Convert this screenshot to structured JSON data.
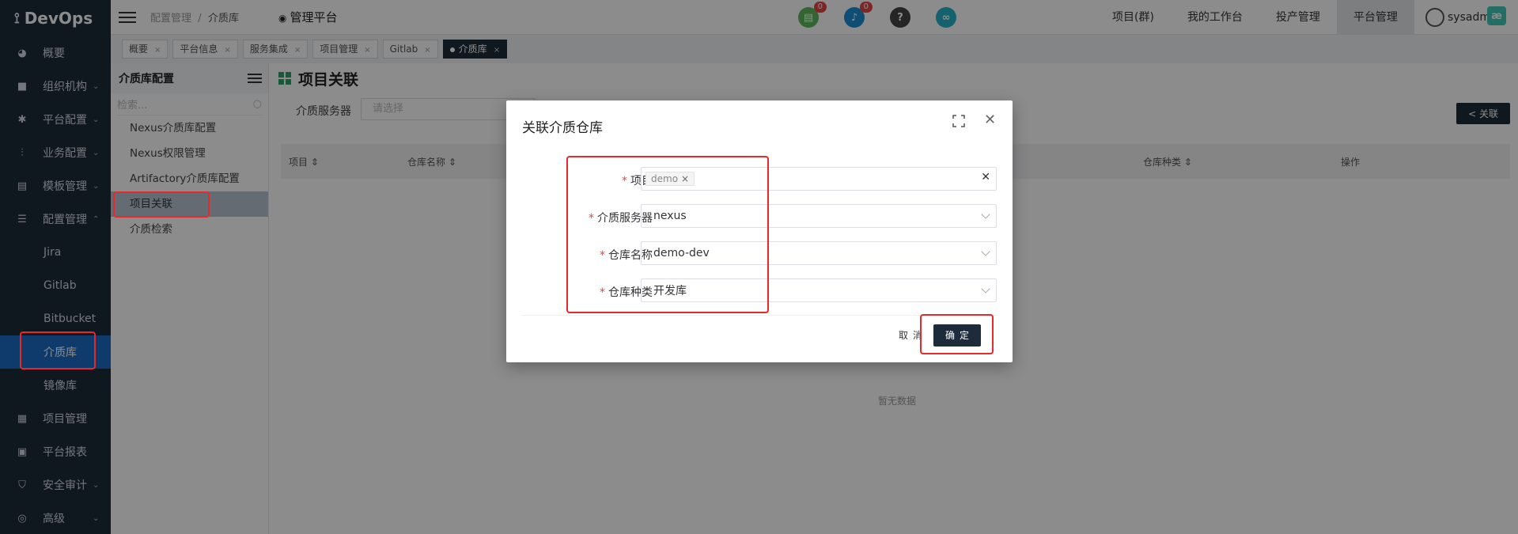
{
  "app": {
    "brand": "DevOps"
  },
  "sidebar": {
    "items": [
      {
        "label": "概要",
        "icon": "dashboard-icon",
        "chev": ""
      },
      {
        "label": "组织机构",
        "icon": "lock-icon",
        "chev": "⌄"
      },
      {
        "label": "平台配置",
        "icon": "gear-icon",
        "chev": "⌄"
      },
      {
        "label": "业务配置",
        "icon": "sliders-icon",
        "chev": "⌄"
      },
      {
        "label": "模板管理",
        "icon": "template-icon",
        "chev": "⌄"
      },
      {
        "label": "配置管理",
        "icon": "database-icon",
        "chev": "⌃"
      }
    ],
    "sub_items": [
      {
        "label": "Jira"
      },
      {
        "label": "Gitlab"
      },
      {
        "label": "Bitbucket"
      },
      {
        "label": "介质库"
      },
      {
        "label": "镜像库"
      }
    ],
    "bottom_items": [
      {
        "label": "项目管理",
        "icon": "grid-icon",
        "chev": ""
      },
      {
        "label": "平台报表",
        "icon": "monitor-icon",
        "chev": ""
      },
      {
        "label": "安全审计",
        "icon": "shield-icon",
        "chev": "⌄"
      },
      {
        "label": "高级",
        "icon": "advanced-icon",
        "chev": "⌄"
      }
    ]
  },
  "topbar": {
    "breadcrumb": {
      "parent": "配置管理",
      "sep": "/",
      "current": "介质库"
    },
    "platform_title": "管理平台",
    "badges": {
      "doc": "0",
      "bell": "0"
    },
    "menu": [
      "项目(群)",
      "我的工作台",
      "投产管理",
      "平台管理"
    ],
    "user": "sysadm",
    "ae": "æ"
  },
  "tabs": [
    {
      "label": "概要"
    },
    {
      "label": "平台信息"
    },
    {
      "label": "服务集成"
    },
    {
      "label": "项目管理"
    },
    {
      "label": "Gitlab"
    },
    {
      "label": "介质库"
    }
  ],
  "subpanel": {
    "title": "介质库配置",
    "search_placeholder": "检索...",
    "items": [
      "Nexus介质库配置",
      "Nexus权限管理",
      "Artifactory介质库配置",
      "项目关联",
      "介质检索"
    ]
  },
  "main": {
    "title": "项目关联",
    "filter_label": "介质服务器",
    "filter_placeholder": "请选择",
    "link_button": "关联",
    "columns": [
      "项目",
      "仓库名称",
      "仓库种类",
      "操作"
    ],
    "empty_text": "暂无数据"
  },
  "modal": {
    "title": "关联介质仓库",
    "fields": {
      "project": {
        "label": "项目",
        "tag": "demo"
      },
      "server": {
        "label": "介质服务器",
        "value": "nexus"
      },
      "repo_name": {
        "label": "仓库名称",
        "value": "demo-dev"
      },
      "repo_type": {
        "label": "仓库种类",
        "value": "开发库"
      }
    },
    "cancel": "取消",
    "confirm": "确定"
  },
  "colors": {
    "sidebar_bg": "#1d2b3a",
    "active_blue": "#1b6cc4",
    "highlight_red": "#e8292b",
    "primary_dark": "#1d2b3a"
  }
}
